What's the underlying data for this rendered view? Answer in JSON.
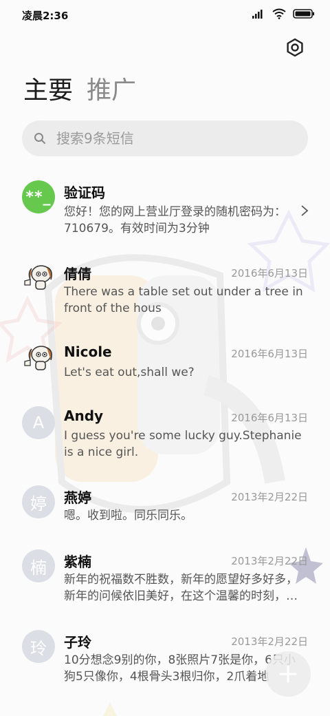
{
  "status": {
    "time": "凌晨2:36"
  },
  "tabs": [
    {
      "label": "主要",
      "active": true
    },
    {
      "label": "推广",
      "active": false
    }
  ],
  "search": {
    "placeholder": "搜索9条短信"
  },
  "conversations": [
    {
      "name": "验证码",
      "avatar": "**_",
      "date": "",
      "preview": "您好！您的网上营业厅登录的随机密码为：710679。有效时间为3分钟"
    },
    {
      "name": "倩倩",
      "avatar": "dog-avatar",
      "date": "2016年6月13日",
      "preview": "There was a table set out under a tree in front of the hous"
    },
    {
      "name": "Nicole",
      "avatar": "dog-avatar",
      "date": "2016年6月13日",
      "preview": "Let's eat out,shall we?"
    },
    {
      "name": "Andy",
      "avatar": "A",
      "date": "2016年6月13日",
      "preview": "I guess you're some lucky guy.Stephanie is a nice girl."
    },
    {
      "name": "燕婷",
      "avatar": "婷",
      "date": "2013年2月22日",
      "preview": "嗯。收到啦。同乐同乐。"
    },
    {
      "name": "紫楠",
      "avatar": "楠",
      "date": "2013年2月22日",
      "preview": "新年的祝福数不胜数，新年的愿望好多好多，新年的问候依旧美好，在这个温馨的时刻，…"
    },
    {
      "name": "子玲",
      "avatar": "玲",
      "date": "2013年2月22日",
      "preview": "10分想念9别的你，8张照片7张是你，6只小狗5只像你，4根骨头3根归你，2爪着地"
    }
  ],
  "colors": {
    "accent_green": "#66c94e",
    "avatar_gray": "#dcdee6",
    "date_gray": "#999999"
  },
  "icons": {
    "settings": "settings-icon",
    "search": "search-icon",
    "chevron": "chevron-right-icon",
    "fab": "add-icon"
  }
}
